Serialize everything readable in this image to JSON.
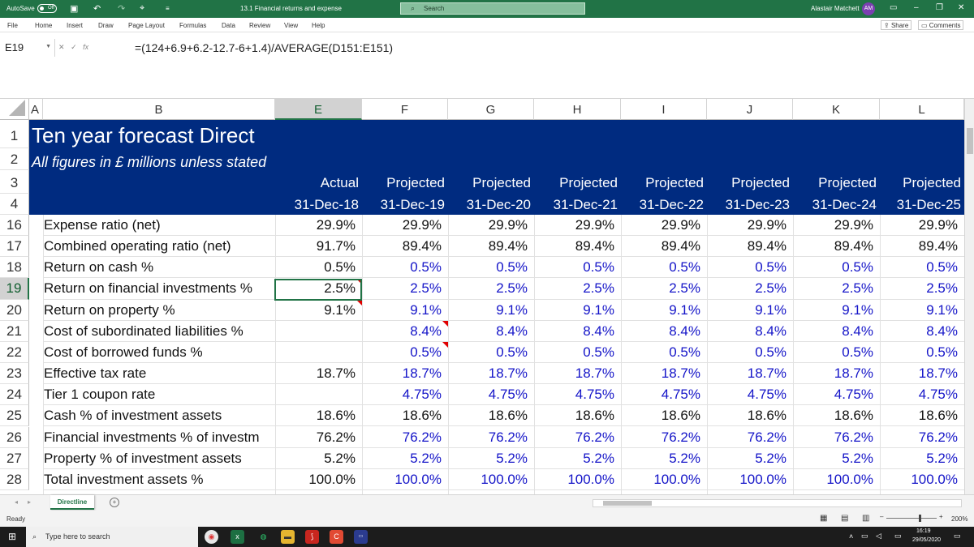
{
  "titlebar": {
    "autosave": "AutoSave",
    "autosave_state": "Off",
    "doc_title": "13.1 Financial returns and expense",
    "search_placeholder": "Search",
    "user": "Alastair Matchett",
    "initials": "AM"
  },
  "menu": [
    "File",
    "Home",
    "Insert",
    "Draw",
    "Page Layout",
    "Formulas",
    "Data",
    "Review",
    "View",
    "Help"
  ],
  "share": "Share",
  "comments": "Comments",
  "namebox": "E19",
  "formula": "=(124+6.9+6.2-12.7-6+1.4)/AVERAGE(D151:E151)",
  "columns": [
    "A",
    "B",
    "E",
    "F",
    "G",
    "H",
    "I",
    "J",
    "K",
    "L"
  ],
  "selected_column": "E",
  "banner": {
    "title": "Ten year forecast Direct",
    "subtitle": "All figures in £ millions unless stated",
    "headers": [
      "Actual",
      "Projected",
      "Projected",
      "Projected",
      "Projected",
      "Projected",
      "Projected",
      "Projected"
    ],
    "dates": [
      "31-Dec-18",
      "31-Dec-19",
      "31-Dec-20",
      "31-Dec-21",
      "31-Dec-22",
      "31-Dec-23",
      "31-Dec-24",
      "31-Dec-25"
    ]
  },
  "header_rows": [
    "1",
    "2",
    "3",
    "4"
  ],
  "rows": [
    {
      "num": "16",
      "label": "Expense ratio (net)",
      "actual": "29.9%",
      "proj": [
        "29.9%",
        "29.9%",
        "29.9%",
        "29.9%",
        "29.9%",
        "29.9%",
        "29.9%"
      ],
      "proj_color": "black"
    },
    {
      "num": "17",
      "label": "Combined operating ratio (net)",
      "actual": "91.7%",
      "proj": [
        "89.4%",
        "89.4%",
        "89.4%",
        "89.4%",
        "89.4%",
        "89.4%",
        "89.4%"
      ],
      "proj_color": "black"
    },
    {
      "num": "18",
      "label": "Return on cash %",
      "actual": "0.5%",
      "proj": [
        "0.5%",
        "0.5%",
        "0.5%",
        "0.5%",
        "0.5%",
        "0.5%",
        "0.5%"
      ],
      "proj_color": "blue"
    },
    {
      "num": "19",
      "label": "Return on financial investments %",
      "actual": "2.5%",
      "proj": [
        "2.5%",
        "2.5%",
        "2.5%",
        "2.5%",
        "2.5%",
        "2.5%",
        "2.5%"
      ],
      "proj_color": "blue"
    },
    {
      "num": "20",
      "label": "Return on property %",
      "actual": "9.1%",
      "proj": [
        "9.1%",
        "9.1%",
        "9.1%",
        "9.1%",
        "9.1%",
        "9.1%",
        "9.1%"
      ],
      "proj_color": "blue"
    },
    {
      "num": "21",
      "label": "Cost of subordinated liabilities %",
      "actual": "",
      "proj": [
        "8.4%",
        "8.4%",
        "8.4%",
        "8.4%",
        "8.4%",
        "8.4%",
        "8.4%"
      ],
      "proj_color": "blue"
    },
    {
      "num": "22",
      "label": "Cost of borrowed funds %",
      "actual": "",
      "proj": [
        "0.5%",
        "0.5%",
        "0.5%",
        "0.5%",
        "0.5%",
        "0.5%",
        "0.5%"
      ],
      "proj_color": "blue"
    },
    {
      "num": "23",
      "label": "Effective tax rate",
      "actual": "18.7%",
      "proj": [
        "18.7%",
        "18.7%",
        "18.7%",
        "18.7%",
        "18.7%",
        "18.7%",
        "18.7%"
      ],
      "proj_color": "blue"
    },
    {
      "num": "24",
      "label": "Tier 1 coupon rate",
      "actual": "",
      "proj": [
        "4.75%",
        "4.75%",
        "4.75%",
        "4.75%",
        "4.75%",
        "4.75%",
        "4.75%"
      ],
      "proj_color": "blue"
    },
    {
      "num": "25",
      "label": "Cash % of investment assets",
      "actual": "18.6%",
      "proj": [
        "18.6%",
        "18.6%",
        "18.6%",
        "18.6%",
        "18.6%",
        "18.6%",
        "18.6%"
      ],
      "proj_color": "black"
    },
    {
      "num": "26",
      "label": "Financial investments % of investm",
      "actual": "76.2%",
      "proj": [
        "76.2%",
        "76.2%",
        "76.2%",
        "76.2%",
        "76.2%",
        "76.2%",
        "76.2%"
      ],
      "proj_color": "blue"
    },
    {
      "num": "27",
      "label": "Property % of investment assets",
      "actual": "5.2%",
      "proj": [
        "5.2%",
        "5.2%",
        "5.2%",
        "5.2%",
        "5.2%",
        "5.2%",
        "5.2%"
      ],
      "proj_color": "blue"
    },
    {
      "num": "28",
      "label": "Total investment assets %",
      "actual": "100.0%",
      "proj": [
        "100.0%",
        "100.0%",
        "100.0%",
        "100.0%",
        "100.0%",
        "100.0%",
        "100.0%"
      ],
      "proj_color": "blue"
    }
  ],
  "colors": {
    "banner": "#002b80",
    "excel_green": "#217346",
    "input_blue": "#1414c8",
    "comment_red": "#e00000"
  },
  "sheet_tab": "Directline",
  "status": {
    "ready": "Ready",
    "zoom": "200%"
  },
  "taskbar": {
    "search_placeholder": "Type here to search",
    "time": "16:19",
    "date": "29/05/2020"
  }
}
